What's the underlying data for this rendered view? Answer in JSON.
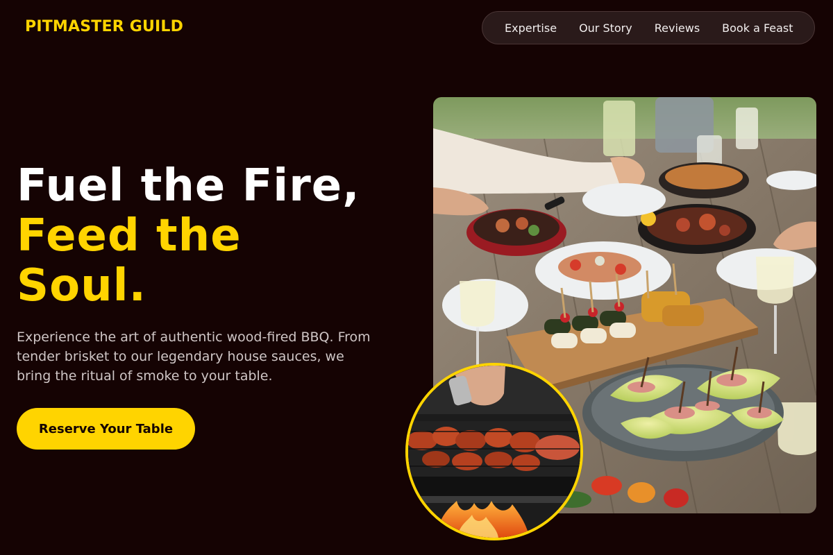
{
  "brand": {
    "name": "PITMASTER GUILD",
    "accent_color": "#ffd400",
    "background_color": "#150303"
  },
  "nav": {
    "items": [
      {
        "label": "Expertise"
      },
      {
        "label": "Our Story"
      },
      {
        "label": "Reviews"
      },
      {
        "label": "Book a Feast"
      }
    ]
  },
  "hero": {
    "headline_line1": "Fuel the Fire,",
    "headline_line2": "Feed the Soul.",
    "description": "Experience the art of authentic wood-fired BBQ. From tender brisket to our legendary house sauces, we bring the ritual of smoke to your table.",
    "cta_label": "Reserve Your Table"
  },
  "images": {
    "main_photo": "outdoor-bbq-feast-table-photo",
    "inset_photo": "grilling-skewers-photo"
  }
}
